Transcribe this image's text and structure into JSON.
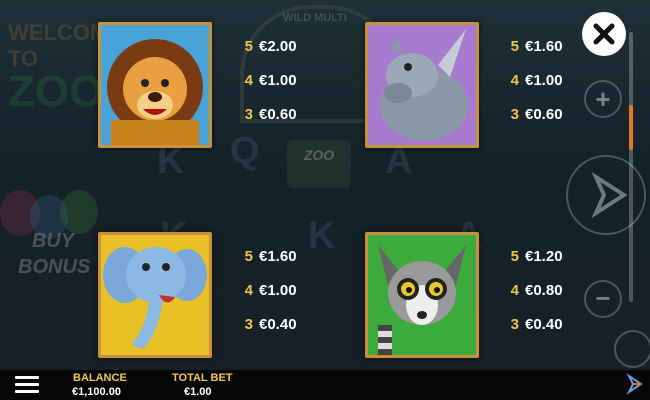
{
  "background": {
    "logo_line1": "WELCOME TO",
    "logo_line2": "ZOO",
    "sign": "WILD MULTI",
    "letters": [
      "K",
      "Q",
      "K",
      "A",
      "K",
      "A"
    ],
    "buy_bonus": [
      "BUY",
      "BONUS"
    ],
    "reel_sign": "ZOO"
  },
  "paytable": {
    "symbols": [
      {
        "animal": "lion",
        "icon": "lion-icon",
        "pays": [
          {
            "count": "5",
            "value": "€2.00"
          },
          {
            "count": "4",
            "value": "€1.00"
          },
          {
            "count": "3",
            "value": "€0.60"
          }
        ]
      },
      {
        "animal": "rhino",
        "icon": "rhino-icon",
        "pays": [
          {
            "count": "5",
            "value": "€1.60"
          },
          {
            "count": "4",
            "value": "€1.00"
          },
          {
            "count": "3",
            "value": "€0.60"
          }
        ]
      },
      {
        "animal": "elephant",
        "icon": "elephant-icon",
        "pays": [
          {
            "count": "5",
            "value": "€1.60"
          },
          {
            "count": "4",
            "value": "€1.00"
          },
          {
            "count": "3",
            "value": "€0.40"
          }
        ]
      },
      {
        "animal": "lemur",
        "icon": "lemur-icon",
        "pays": [
          {
            "count": "5",
            "value": "€1.20"
          },
          {
            "count": "4",
            "value": "€0.80"
          },
          {
            "count": "3",
            "value": "€0.40"
          }
        ]
      }
    ]
  },
  "controls": {
    "plus": "+",
    "minus": "−",
    "close_icon": "close-icon",
    "spin_icon": "spin-icon"
  },
  "bottom_bar": {
    "balance_label": "BALANCE",
    "balance_value": "€1,100.00",
    "total_bet_label": "TOTAL BET",
    "total_bet_value": "€1.00"
  },
  "colors": {
    "accent": "#f1c64a",
    "frame": "#c8913a",
    "scroll": "#e87722"
  }
}
